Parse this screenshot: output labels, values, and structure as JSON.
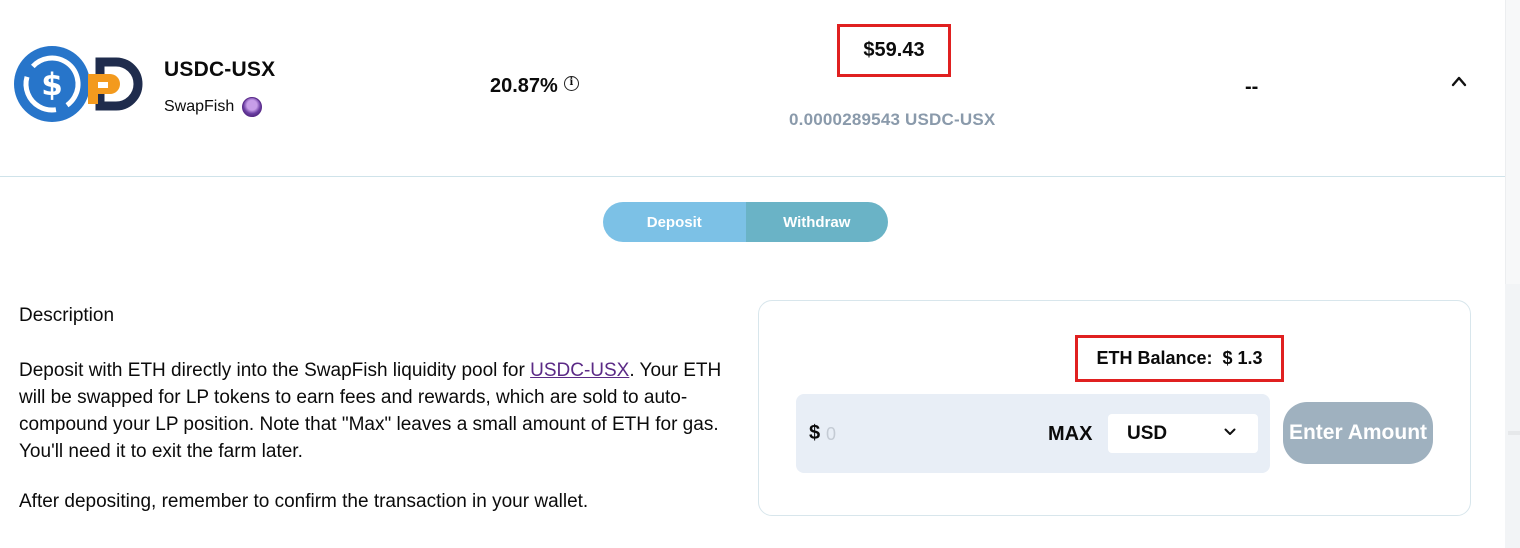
{
  "farm": {
    "pair_name": "USDC-USX",
    "platform": "SwapFish",
    "apy": "20.87%",
    "deposit_value": "$59.43",
    "deposit_tokens": "0.0000289543 USDC-USX",
    "rewards": "--",
    "icons": {
      "token_a": "usdc-logo",
      "token_b": "usx-logo",
      "platform": "swapfish-logo",
      "info": "info-icon",
      "collapse": "chevron-up-icon"
    }
  },
  "tabs": {
    "deposit": "Deposit",
    "withdraw": "Withdraw"
  },
  "description": {
    "title": "Description",
    "body_before_link": "Deposit with ETH directly into the SwapFish liquidity pool for ",
    "link_text": "USDC-USX",
    "body_after_link": ". Your ETH will be swapped for LP tokens to earn fees and rewards, which are sold to auto-compound your LP position. Note that \"Max\" leaves a small amount of ETH for gas. You'll need it to exit the farm later.",
    "note": "After depositing, remember to confirm the transaction in your wallet."
  },
  "deposit_form": {
    "balance_label": "ETH Balance:",
    "balance_value": "$ 1.3",
    "currency_symbol": "$",
    "amount_placeholder": "0",
    "max_label": "MAX",
    "currency_selected": "USD",
    "submit_label": "Enter Amount"
  },
  "colors": {
    "highlight_box": "#e02020",
    "tab_deposit": "#7cc1e6",
    "tab_withdraw": "#6ab3c6",
    "usdc_blue": "#2775ca",
    "usx_orange": "#f39a1e",
    "link_purple": "#5b2a86",
    "button_disabled": "#9fb1bf"
  }
}
